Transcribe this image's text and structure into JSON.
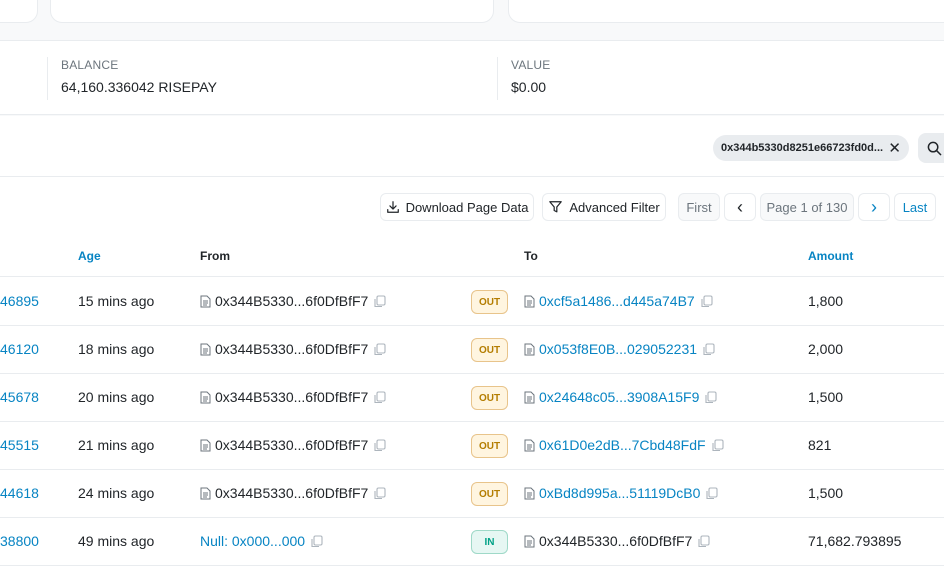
{
  "balance": {
    "label": "BALANCE",
    "value": "64,160.336042 RISEPAY"
  },
  "value": {
    "label": "VALUE",
    "value": "$0.00"
  },
  "filter": {
    "chip_text": "0x344b5330d8251e66723fd0d...",
    "close_symbol": "✕"
  },
  "toolbar": {
    "download_label": "Download Page Data",
    "advanced_filter_label": "Advanced Filter",
    "first_label": "First",
    "prev_symbol": "‹",
    "page_label": "Page 1 of 130",
    "next_symbol": "›",
    "last_label": "Last"
  },
  "table": {
    "headers": {
      "age": "Age",
      "from": "From",
      "to": "To",
      "amount": "Amount"
    },
    "rows": [
      {
        "id": "46895",
        "age": "15 mins ago",
        "from": "0x344B5330...6f0DfBfF7",
        "direction": "OUT",
        "to": "0xcf5a1486...d445a74B7",
        "amount": "1,800"
      },
      {
        "id": "46120",
        "age": "18 mins ago",
        "from": "0x344B5330...6f0DfBfF7",
        "direction": "OUT",
        "to": "0x053f8E0B...029052231",
        "amount": "2,000"
      },
      {
        "id": "45678",
        "age": "20 mins ago",
        "from": "0x344B5330...6f0DfBfF7",
        "direction": "OUT",
        "to": "0x24648c05...3908A15F9",
        "amount": "1,500"
      },
      {
        "id": "45515",
        "age": "21 mins ago",
        "from": "0x344B5330...6f0DfBfF7",
        "direction": "OUT",
        "to": "0x61D0e2dB...7Cbd48FdF",
        "amount": "821"
      },
      {
        "id": "44618",
        "age": "24 mins ago",
        "from": "0x344B5330...6f0DfBfF7",
        "direction": "OUT",
        "to": "0xBd8d995a...51119DcB0",
        "amount": "1,500"
      },
      {
        "id": "38800",
        "age": "49 mins ago",
        "from": "Null: 0x000...000",
        "direction": "IN",
        "to": "0x344B5330...6f0DfBfF7",
        "amount": "71,682.793895"
      }
    ]
  },
  "colors": {
    "link": "#0784c3",
    "out_badge": "#b47d00",
    "in_badge": "#00a186"
  }
}
